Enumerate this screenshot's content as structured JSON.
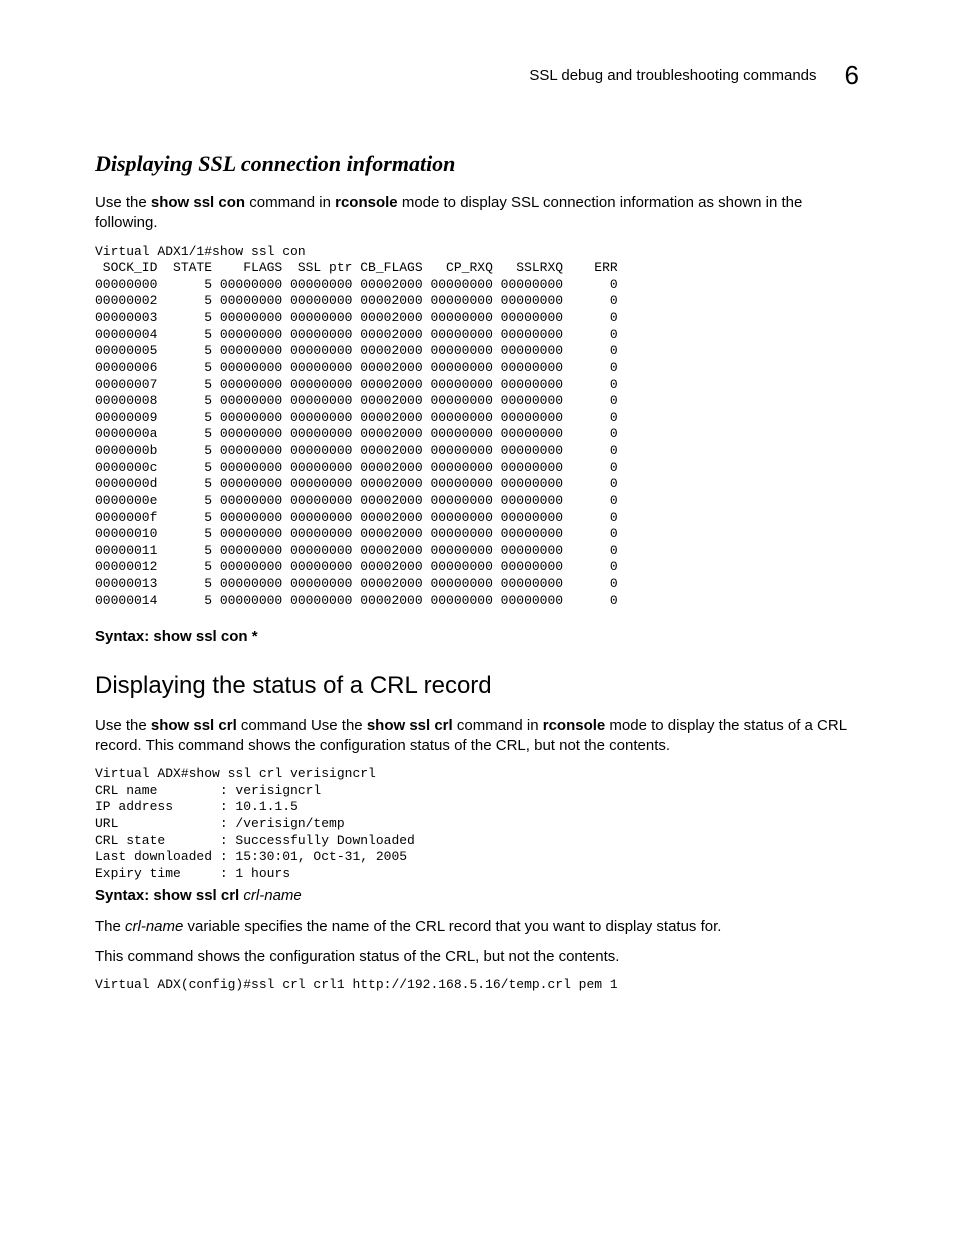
{
  "header": {
    "section": "SSL debug and troubleshooting commands",
    "chapter_number": "6"
  },
  "s1": {
    "title": "Displaying SSL connection information",
    "intro_pre": "Use the ",
    "intro_cmd": "show ssl con",
    "intro_mid": " command in ",
    "intro_mode": "rconsole",
    "intro_post": " mode to display SSL connection information as shown in the following.",
    "terminal": "Virtual ADX1/1#show ssl con\n SOCK_ID  STATE    FLAGS  SSL ptr CB_FLAGS   CP_RXQ   SSLRXQ    ERR\n00000000      5 00000000 00000000 00002000 00000000 00000000      0\n00000002      5 00000000 00000000 00002000 00000000 00000000      0\n00000003      5 00000000 00000000 00002000 00000000 00000000      0\n00000004      5 00000000 00000000 00002000 00000000 00000000      0\n00000005      5 00000000 00000000 00002000 00000000 00000000      0\n00000006      5 00000000 00000000 00002000 00000000 00000000      0\n00000007      5 00000000 00000000 00002000 00000000 00000000      0\n00000008      5 00000000 00000000 00002000 00000000 00000000      0\n00000009      5 00000000 00000000 00002000 00000000 00000000      0\n0000000a      5 00000000 00000000 00002000 00000000 00000000      0\n0000000b      5 00000000 00000000 00002000 00000000 00000000      0\n0000000c      5 00000000 00000000 00002000 00000000 00000000      0\n0000000d      5 00000000 00000000 00002000 00000000 00000000      0\n0000000e      5 00000000 00000000 00002000 00000000 00000000      0\n0000000f      5 00000000 00000000 00002000 00000000 00000000      0\n00000010      5 00000000 00000000 00002000 00000000 00000000      0\n00000011      5 00000000 00000000 00002000 00000000 00000000      0\n00000012      5 00000000 00000000 00002000 00000000 00000000      0\n00000013      5 00000000 00000000 00002000 00000000 00000000      0\n00000014      5 00000000 00000000 00002000 00000000 00000000      0",
    "syntax_label": "Syntax: ",
    "syntax_cmd": "show ssl con *"
  },
  "s2": {
    "title": "Displaying the status of a CRL record",
    "intro_pre": "Use the ",
    "intro_cmd1": "show ssl crl",
    "intro_mid1": " command Use the ",
    "intro_cmd2": "show ssl crl",
    "intro_mid2": " command in ",
    "intro_mode": "rconsole",
    "intro_post": " mode to display the status of a CRL record. This command shows the configuration status of the CRL, but not the contents.",
    "terminal": "Virtual ADX#show ssl crl verisigncrl\nCRL name        : verisigncrl\nIP address      : 10.1.1.5\nURL             : /verisign/temp\nCRL state       : Successfully Downloaded\nLast downloaded : 15:30:01, Oct-31, 2005\nExpiry time     : 1 hours",
    "syntax_label": "Syntax: ",
    "syntax_cmd": "show ssl crl",
    "syntax_var": " crl-name",
    "var_sentence_pre": "The ",
    "var_sentence_var": "crl-name",
    "var_sentence_post": " variable specifies the name of the CRL record that you want to display status for.",
    "note_para": "This command shows the configuration status of the CRL, but not the contents.",
    "terminal2": "Virtual ADX(config)#ssl crl crl1 http://192.168.5.16/temp.crl pem 1"
  }
}
